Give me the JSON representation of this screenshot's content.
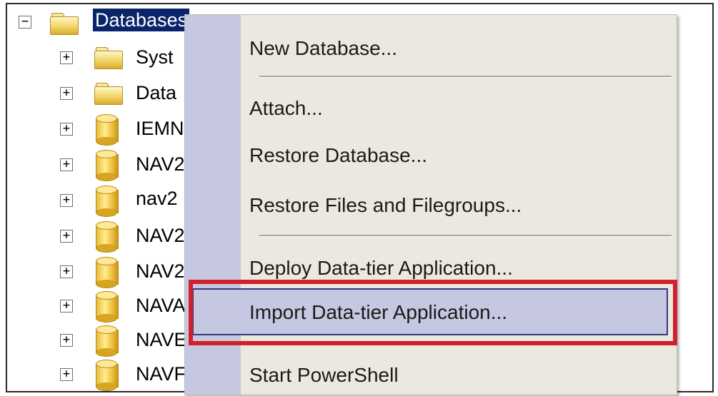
{
  "tree": {
    "root": {
      "label": "Databases",
      "expander": "−"
    },
    "children": [
      {
        "label": "Syst",
        "icon": "folder-icon",
        "expander": "+"
      },
      {
        "label": "Data",
        "icon": "folder-icon",
        "expander": "+"
      },
      {
        "label": "IEMN",
        "icon": "database-icon",
        "expander": "+"
      },
      {
        "label": "NAV2",
        "icon": "database-icon",
        "expander": "+"
      },
      {
        "label": "nav2",
        "icon": "database-icon",
        "expander": "+"
      },
      {
        "label": "NAV2",
        "icon": "database-icon",
        "expander": "+"
      },
      {
        "label": "NAV2",
        "icon": "database-icon",
        "expander": "+"
      },
      {
        "label": "NAVA",
        "icon": "database-icon",
        "expander": "+"
      },
      {
        "label": "NAVE",
        "icon": "database-icon",
        "expander": "+"
      },
      {
        "label": "NAVF",
        "icon": "database-icon",
        "expander": "+"
      }
    ]
  },
  "context_menu": {
    "items": [
      {
        "label": "New Database..."
      },
      {
        "label": "Attach..."
      },
      {
        "label": "Restore Database..."
      },
      {
        "label": "Restore Files and Filegroups..."
      },
      {
        "label": "Deploy Data-tier Application..."
      },
      {
        "label": "Import Data-tier Application...",
        "highlighted": true
      },
      {
        "label": "Start PowerShell"
      }
    ]
  },
  "colors": {
    "highlight_border": "#d11f2c",
    "selection": "#0a246a",
    "menu_gutter": "#c5c8e0"
  }
}
